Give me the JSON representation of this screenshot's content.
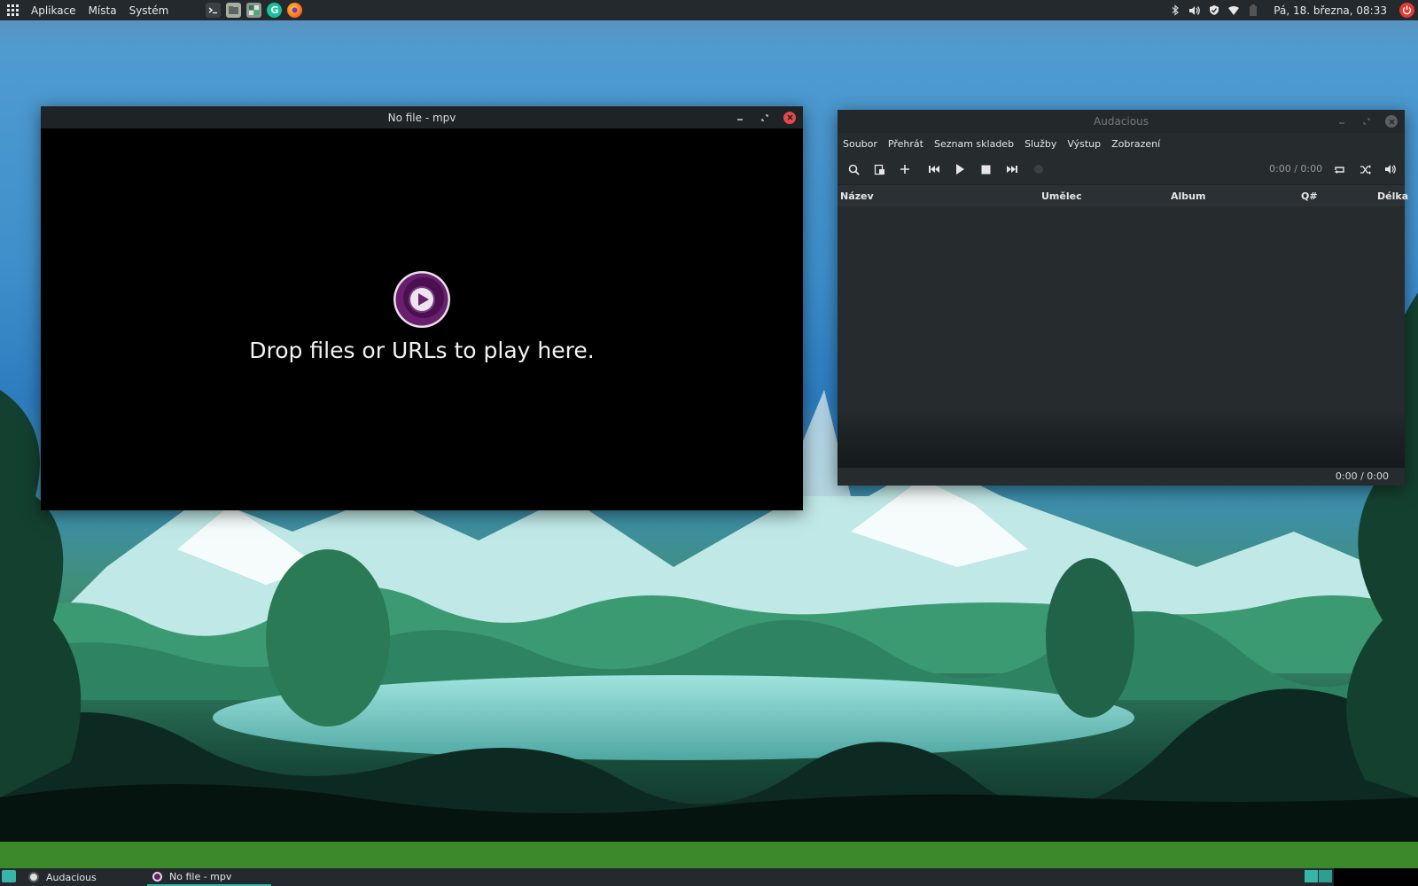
{
  "top_panel": {
    "menus": [
      "Aplikace",
      "Místa",
      "Systém"
    ],
    "launchers": [
      "terminal-icon",
      "file-manager-icon",
      "system-monitor-icon",
      "grammarly-icon",
      "firefox-icon"
    ],
    "tray_icons": [
      "bluetooth-icon",
      "volume-icon",
      "shield-icon",
      "wifi-icon",
      "battery-icon"
    ],
    "clock": "Pá, 18. března, 08:33"
  },
  "mpv": {
    "title": "No file - mpv",
    "drop_text": "Drop files or URLs to play here."
  },
  "audacious": {
    "title": "Audacious",
    "menus": [
      "Soubor",
      "Přehrát",
      "Seznam skladeb",
      "Služby",
      "Výstup",
      "Zobrazení"
    ],
    "time": "0:00 / 0:00",
    "columns": {
      "title": "Název",
      "artist": "Umělec",
      "album": "Album",
      "queue": "Q#",
      "length": "Délka"
    },
    "status_time": "0:00 / 0:00"
  },
  "taskbar": {
    "tasks": [
      "Audacious",
      "No file - mpv"
    ]
  },
  "colors": {
    "accent": "#37b5a6",
    "mpv_purple": "#6a1f6e",
    "close_red": "#e24a4a",
    "green_strip": "#3a8a2b"
  }
}
